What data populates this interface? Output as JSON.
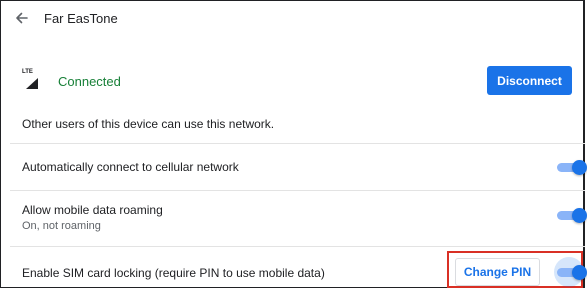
{
  "header": {
    "title": "Far EasTone"
  },
  "connection": {
    "network_type": "LTE",
    "status": "Connected",
    "disconnect_label": "Disconnect"
  },
  "info_text": "Other users of this device can use this network.",
  "settings": [
    {
      "label": "Automatically connect to cellular network",
      "enabled": true
    },
    {
      "label": "Allow mobile data roaming",
      "sublabel": "On, not roaming",
      "enabled": true
    },
    {
      "label": "Enable SIM card locking (require PIN to use mobile data)",
      "enabled": true,
      "button_label": "Change PIN"
    }
  ],
  "colors": {
    "accent": "#1a73e8",
    "status_green": "#188038",
    "highlight_red": "#d93025"
  }
}
